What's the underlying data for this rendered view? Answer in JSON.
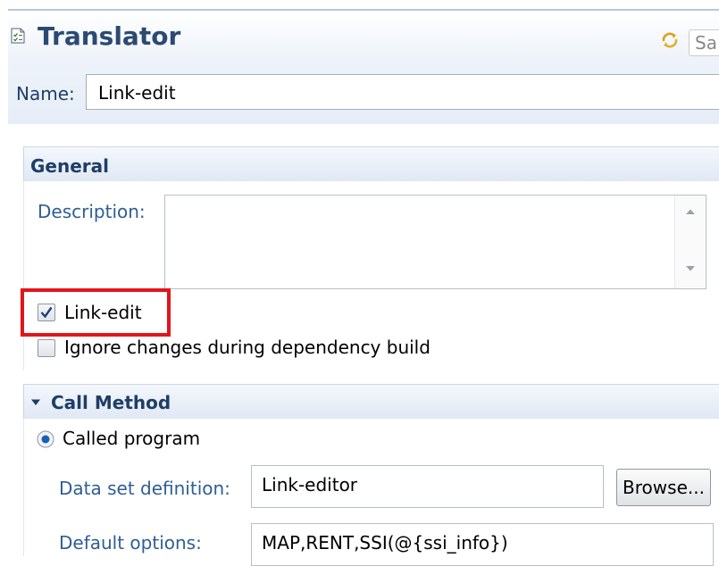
{
  "editor": {
    "title": "Translator",
    "icons": {
      "title": "document-check-icon",
      "sync": "sync-arrows-icon"
    },
    "save_field_text": "Sa"
  },
  "name_field": {
    "label": "Name:",
    "value": "Link-edit"
  },
  "general": {
    "title": "General",
    "description_label": "Description:",
    "description_value": "",
    "link_edit": {
      "label": "Link-edit",
      "checked": true
    },
    "ignore_changes": {
      "label": "Ignore changes during dependency build",
      "checked": false
    }
  },
  "call_method": {
    "title": "Call Method",
    "called_program": {
      "label": "Called program",
      "selected": true
    },
    "data_set_definition": {
      "label": "Data set definition:",
      "value": "Link-editor",
      "browse_label": "Browse..."
    },
    "default_options": {
      "label": "Default options:",
      "value": "MAP,RENT,SSI(@{ssi_info})"
    }
  },
  "colors": {
    "title": "#2b4a73",
    "label": "#2f5e94",
    "highlight": "#e3151a",
    "radio_fill": "#1a5fb4"
  }
}
